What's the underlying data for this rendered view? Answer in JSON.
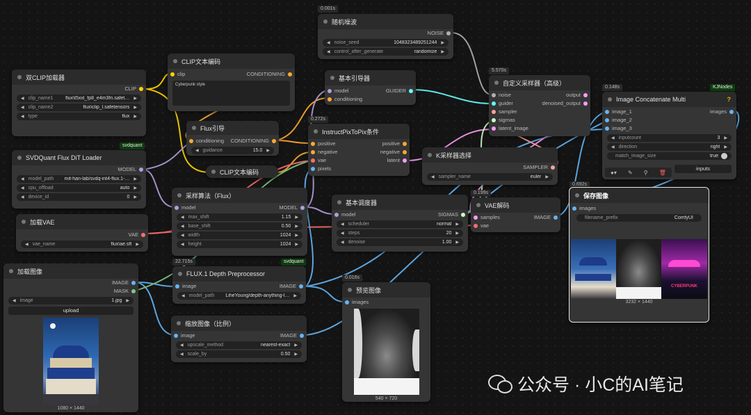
{
  "colors": {
    "clip": "#ffd500",
    "cond": "#ffa931",
    "model": "#b39ddb",
    "vae": "#ff6e6e",
    "image": "#64b5f6",
    "noise": "#b0b0b0",
    "latent": "#ff9cf9",
    "guider": "#66ffff",
    "sampler": "#ffa0a0",
    "sigmas": "#cdffcd",
    "mask": "#81c784",
    "int": "#29699c"
  },
  "dual_clip": {
    "title": "双CLIP加载器",
    "out": "CLIP",
    "w1k": "clip_name1",
    "w1v": "flux\\t5xxl_fp8_e4m3fn.safet…",
    "w2k": "clip_name2",
    "w2v": "flux\\clip_l.safetensors",
    "w3k": "type",
    "w3v": "flux"
  },
  "clip_enc1": {
    "title": "CLIP文本编码",
    "in": "clip",
    "out": "CONDITIONING",
    "text": "Cyberpunk style"
  },
  "flux_guide": {
    "title": "Flux引导",
    "in": "conditioning",
    "out": "CONDITIONING",
    "wk": "guidance",
    "wv": "15.0"
  },
  "clip_enc2": {
    "title": "CLIP文本编码"
  },
  "svd_loader": {
    "title": "SVDQuant Flux DiT Loader",
    "tag": "svdquant",
    "out": "MODEL",
    "w1k": "model_path",
    "w1v": "mit-han-lab/svdq-int4-flux.1-…",
    "w2k": "cpu_offload",
    "w2v": "auto",
    "w3k": "device_id",
    "w3v": "0"
  },
  "load_vae": {
    "title": "加载VAE",
    "out": "VAE",
    "wk": "vae_name",
    "wv": "flux\\ae.sft"
  },
  "load_image": {
    "title": "加载图像",
    "out1": "IMAGE",
    "out2": "MASK",
    "wk": "image",
    "wv": "1.jpg",
    "btn": "upload",
    "cap": "1080 × 1440"
  },
  "random_noise": {
    "badge": "0.001s",
    "title": "随机噪波",
    "out": "NOISE",
    "w1k": "noise_seed",
    "w1v": "1048323489251244",
    "w2k": "control_after_generate",
    "w2v": "randomize"
  },
  "basic_guider": {
    "title": "基本引导器",
    "in1": "model",
    "in2": "conditioning",
    "out": "GUIDER"
  },
  "ip2p": {
    "badge": "0.272s",
    "title": "InstructPixToPix条件",
    "in1": "positive",
    "in2": "negative",
    "in3": "vae",
    "in4": "pixels",
    "out1": "positive",
    "out2": "negative",
    "out3": "latent"
  },
  "custom_sampler": {
    "badge": "5.570s",
    "title": "自定义采样器（高级）",
    "in1": "noise",
    "in2": "guider",
    "in3": "sampler",
    "in4": "sigmas",
    "in5": "latent_image",
    "out1": "output",
    "out2": "denoised_output"
  },
  "ksampler_select": {
    "title": "K采样器选择",
    "out": "SAMPLER",
    "wk": "sampler_name",
    "wv": "euler"
  },
  "model_sampling": {
    "title": "采样算法（Flux）",
    "in": "model",
    "out": "MODEL",
    "w1k": "max_shift",
    "w1v": "1.15",
    "w2k": "base_shift",
    "w2v": "0.50",
    "w3k": "width",
    "w3v": "1024",
    "w4k": "height",
    "w4v": "1024"
  },
  "basic_scheduler": {
    "title": "基本调度器",
    "in": "model",
    "out": "SIGMAS",
    "w1k": "scheduler",
    "w1v": "normal",
    "w2k": "steps",
    "w2v": "20",
    "w3k": "denoise",
    "w3v": "1.00"
  },
  "vae_decode": {
    "badge": "0.199s",
    "title": "VAE解码",
    "in1": "samples",
    "in2": "vae",
    "out": "IMAGE"
  },
  "depth": {
    "badge": "22.715s",
    "tag": "svdquant",
    "title": "FLUX.1 Depth Preprocessor",
    "in": "image",
    "out": "IMAGE",
    "wk": "model_path",
    "wv": "LiheYoung/depth-anything-l…"
  },
  "upscale": {
    "title": "缩放图像（比例）",
    "in": "image",
    "out": "IMAGE",
    "w1k": "upscale_method",
    "w1v": "nearest-exact",
    "w2k": "scale_by",
    "w2v": "0.50"
  },
  "preview": {
    "badge": "0.016s",
    "title": "预览图像",
    "in": "images",
    "cap": "540 × 720"
  },
  "concat": {
    "badge": "0.148s",
    "tag": "KJNodes",
    "help": "?",
    "title": "Image Concatenate Multi",
    "in1": "image_1",
    "in2": "image_2",
    "in3": "image_3",
    "out": "images",
    "w1k": "inputcount",
    "w1v": "3",
    "w2k": "direction",
    "w2v": "right",
    "w3k": "match_image_size",
    "w3v": "true",
    "btn": "inputs"
  },
  "save": {
    "badge": "0.692s",
    "title": "保存图像",
    "in": "images",
    "wk": "filename_prefix",
    "wv": "ComfyUI",
    "cap": "3232 × 1440"
  },
  "watermark": {
    "text": "公众号 · 小C的AI笔记"
  }
}
